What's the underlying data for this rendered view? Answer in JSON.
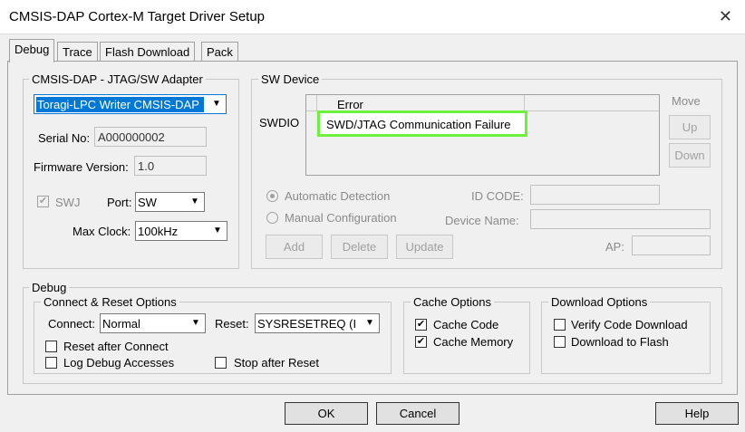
{
  "window": {
    "title": "CMSIS-DAP Cortex-M Target Driver Setup"
  },
  "tabs": [
    {
      "label": "Debug"
    },
    {
      "label": "Trace"
    },
    {
      "label": "Flash Download"
    },
    {
      "label": "Pack"
    }
  ],
  "adapter": {
    "group_label": "CMSIS-DAP - JTAG/SW Adapter",
    "selected": "Toragi-LPC Writer CMSIS-DAP",
    "serial_label": "Serial No:",
    "serial_value": "A000000002",
    "firmware_label": "Firmware Version:",
    "firmware_value": "1.0",
    "swj_label": "SWJ",
    "port_label": "Port:",
    "port_value": "SW",
    "maxclock_label": "Max Clock:",
    "maxclock_value": "100kHz"
  },
  "sw_device": {
    "group_label": "SW Device",
    "swdio_label": "SWDIO",
    "column_header": "Error",
    "error_message": "SWD/JTAG Communication Failure",
    "move_label": "Move",
    "up_label": "Up",
    "down_label": "Down",
    "auto_detect_label": "Automatic Detection",
    "manual_config_label": "Manual Configuration",
    "id_code_label": "ID CODE:",
    "device_name_label": "Device Name:",
    "ap_label": "AP:",
    "add_label": "Add",
    "delete_label": "Delete",
    "update_label": "Update"
  },
  "debug": {
    "group_label": "Debug",
    "connect_reset_label": "Connect & Reset Options",
    "connect_label": "Connect:",
    "connect_value": "Normal",
    "reset_label": "Reset:",
    "reset_value": "SYSRESETREQ (I",
    "reset_after_connect": "Reset after Connect",
    "log_debug_accesses": "Log Debug Accesses",
    "stop_after_reset": "Stop after Reset",
    "cache_options_label": "Cache Options",
    "cache_code": "Cache Code",
    "cache_memory": "Cache Memory",
    "download_options_label": "Download Options",
    "verify_code_download": "Verify Code Download",
    "download_to_flash": "Download to Flash"
  },
  "footer": {
    "ok_label": "OK",
    "cancel_label": "Cancel",
    "help_label": "Help"
  },
  "colors": {
    "selection": "#0078d7",
    "highlight": "#6cf23c"
  },
  "icons": {
    "close": "close-icon",
    "dropdown": "chevron-down-icon",
    "check": "check-icon"
  }
}
